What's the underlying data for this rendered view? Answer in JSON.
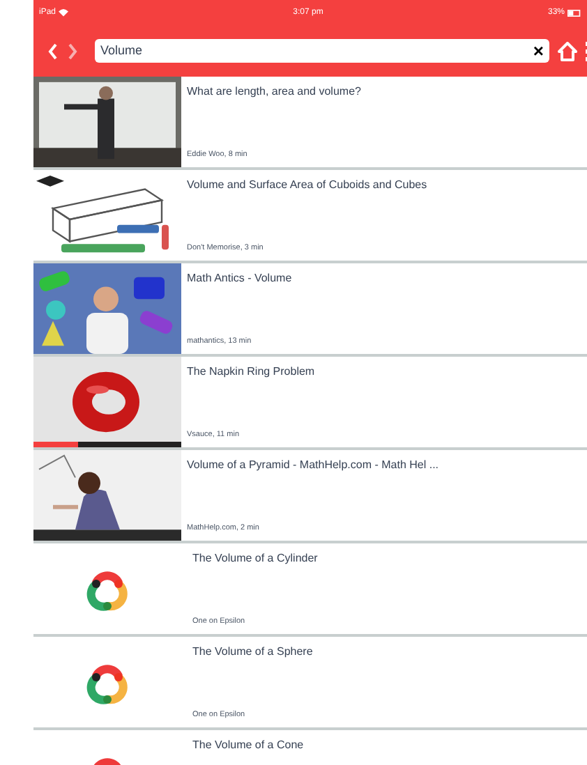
{
  "status_bar": {
    "device": "iPad",
    "time": "3:07 pm",
    "battery": "33%"
  },
  "search": {
    "value": "Volume",
    "clear": "×"
  },
  "videos": [
    {
      "title": "What are length, area and volume?",
      "meta": "Eddie Woo, 8 min"
    },
    {
      "title": "Volume and Surface Area of Cuboids and Cubes",
      "meta": "Don't Memorise, 3 min"
    },
    {
      "title": "Math Antics - Volume",
      "meta": "mathantics, 13 min"
    },
    {
      "title": "The Napkin Ring Problem",
      "meta": "Vsauce, 11 min",
      "level": 0.3
    },
    {
      "title": "Volume of a Pyramid - MathHelp.com - Math Hel ...",
      "meta": "MathHelp.com, 2 min"
    },
    {
      "title": "The Volume of a Cylinder",
      "meta": "One on Epsilon",
      "thumb": {
        "kind": "logo"
      }
    },
    {
      "title": "The Volume of a Sphere",
      "meta": "One on Epsilon",
      "thumb": {
        "kind": "logo"
      }
    },
    {
      "title": "The Volume of a Cone",
      "thumb": {
        "kind": "logo"
      }
    }
  ]
}
